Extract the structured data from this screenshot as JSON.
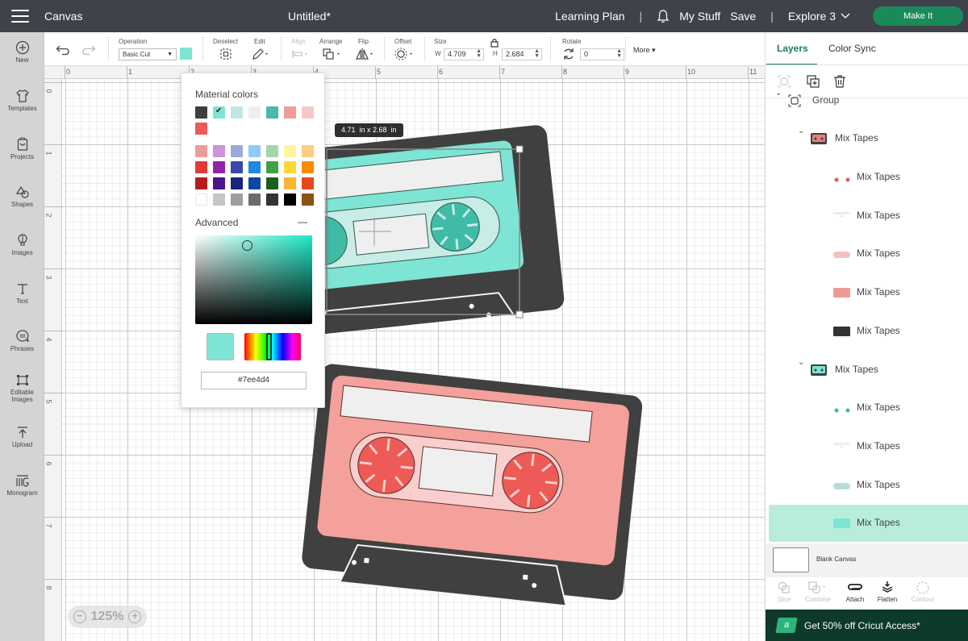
{
  "topbar": {
    "app_title": "Canvas",
    "doc_title": "Untitled*",
    "learning_plan": "Learning Plan",
    "separator": "|",
    "my_stuff": "My Stuff",
    "save": "Save",
    "machine": "Explore 3",
    "make_it": "Make It"
  },
  "sidebar": {
    "items": [
      {
        "label": "New",
        "icon": "plus-circle-icon"
      },
      {
        "label": "Templates",
        "icon": "tshirt-icon"
      },
      {
        "label": "Projects",
        "icon": "projects-icon"
      },
      {
        "label": "Shapes",
        "icon": "shapes-icon"
      },
      {
        "label": "Images",
        "icon": "lightbulb-icon"
      },
      {
        "label": "Text",
        "icon": "text-icon"
      },
      {
        "label": "Phrases",
        "icon": "speech-bubble-icon"
      },
      {
        "label": "Editable",
        "label2": "Images",
        "icon": "editable-images-icon"
      },
      {
        "label": "Upload",
        "icon": "upload-icon"
      },
      {
        "label": "Monogram",
        "icon": "monogram-icon"
      }
    ]
  },
  "toolbar": {
    "operation_label": "Operation",
    "operation_value": "Basic Cut",
    "operation_color": "#7ee4d4",
    "deselect": "Deselect",
    "edit": "Edit",
    "align": "Align",
    "arrange": "Arrange",
    "flip": "Flip",
    "offset": "Offset",
    "size": "Size",
    "w_label": "W",
    "w_value": "4.709",
    "h_label": "H",
    "h_value": "2.684",
    "rotate": "Rotate",
    "rotate_value": "0",
    "more": "More ▾"
  },
  "rulers": {
    "top": [
      "0",
      "1",
      "2",
      "3",
      "4",
      "5",
      "6",
      "7",
      "8",
      "9",
      "10",
      "11"
    ],
    "left": [
      "0",
      "1",
      "2",
      "3",
      "4",
      "5",
      "6",
      "7",
      "8"
    ]
  },
  "canvas": {
    "dimension_tooltip": "4.71  in x 2.68  in",
    "zoom": "125%",
    "tapes": [
      {
        "name": "teal tape",
        "body": "#404040",
        "label": "#7ee4d4",
        "window": "#c8ece6",
        "reel": "#3fbba6"
      },
      {
        "name": "pink tape",
        "body": "#404040",
        "label": "#f4a09b",
        "window": "#f9cfcd",
        "reel": "#ee5a55"
      }
    ]
  },
  "color_popover": {
    "material_title": "Material colors",
    "material_colors": [
      "#3e3e3e",
      "#7ee4d4",
      "#c2e6e1",
      "#efefef",
      "#45bba8",
      "#f19c99",
      "#f7c7c7",
      "#ef5a57"
    ],
    "selected_index": 1,
    "palette": [
      [
        "#ef9a9a",
        "#ce93d8",
        "#9fa8da",
        "#90caf9",
        "#a5d6a7",
        "#fff59d",
        "#ffcc80"
      ],
      [
        "#e53935",
        "#8e24aa",
        "#3949ab",
        "#1e88e5",
        "#43a047",
        "#fdd835",
        "#fb8c00"
      ],
      [
        "#b71c1c",
        "#4a148c",
        "#1a237e",
        "#0d47a1",
        "#1b5e20",
        "#f9b633",
        "#e64a19"
      ],
      [
        "#ffffff",
        "#c6c6c6",
        "#9e9e9e",
        "#6b6b6b",
        "#333333",
        "#000000",
        "#8b5117"
      ]
    ],
    "advanced_title": "Advanced",
    "collapse": "—",
    "hex_value": "#7ee4d4"
  },
  "panel": {
    "tabs": [
      {
        "label": "Layers",
        "active": true
      },
      {
        "label": "Color Sync",
        "active": false
      }
    ],
    "layers": [
      {
        "label": "Group",
        "level": 0,
        "expanded": true,
        "thumb": "group"
      },
      {
        "label": "Mix Tapes",
        "level": 1,
        "expanded": true,
        "thumb": "pink-tape"
      },
      {
        "label": "Mix Tapes",
        "level": 2,
        "thumb": "dots",
        "color": "#d9615b"
      },
      {
        "label": "Mix Tapes",
        "level": 2,
        "thumb": "white",
        "color": "#efefef"
      },
      {
        "label": "Mix Tapes",
        "level": 2,
        "thumb": "pill",
        "color": "#f3c0c0"
      },
      {
        "label": "Mix Tapes",
        "level": 2,
        "thumb": "rect",
        "color": "#f09a96"
      },
      {
        "label": "Mix Tapes",
        "level": 2,
        "thumb": "rect",
        "color": "#333333"
      },
      {
        "label": "Mix Tapes",
        "level": 1,
        "expanded": true,
        "thumb": "teal-tape"
      },
      {
        "label": "Mix Tapes",
        "level": 2,
        "thumb": "dots",
        "color": "#4bb59f"
      },
      {
        "label": "Mix Tapes",
        "level": 2,
        "thumb": "white",
        "color": "#efefef"
      },
      {
        "label": "Mix Tapes",
        "level": 2,
        "thumb": "pill",
        "color": "#b9dcd7"
      },
      {
        "label": "Mix Tapes",
        "level": 2,
        "thumb": "rect",
        "color": "#7ee4d4",
        "selected": true
      }
    ],
    "blank_canvas": "Blank Canvas",
    "bottom_tools": [
      {
        "label": "Slice",
        "enabled": false
      },
      {
        "label": "Combine",
        "enabled": false
      },
      {
        "label": "Attach",
        "enabled": true
      },
      {
        "label": "Flatten",
        "enabled": true
      },
      {
        "label": "Contour",
        "enabled": false
      }
    ],
    "promo": "Get 50% off Cricut Access*",
    "promo_logo": "a"
  }
}
